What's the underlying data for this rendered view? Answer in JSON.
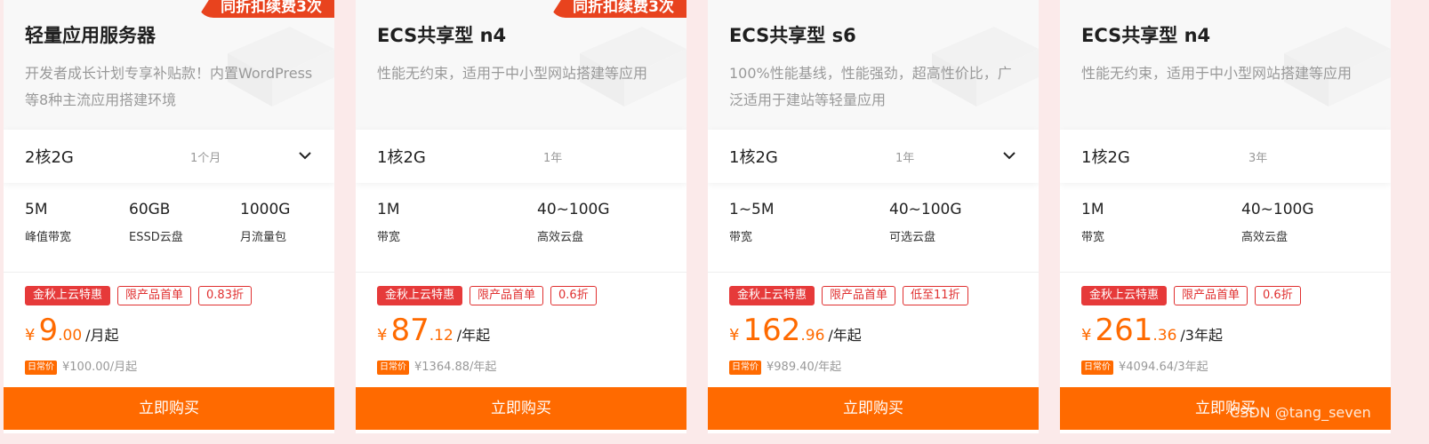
{
  "colors": {
    "accent": "#ff6a00",
    "ribbon": "#e8431e",
    "tag_red": "#e63a3a"
  },
  "icons": {
    "dropdown": "chevron-down-icon"
  },
  "cards": [
    {
      "ribbon": "同折扣续费3次",
      "title": "轻量应用服务器",
      "desc": "开发者成长计划专享补贴款！内置WordPress等8种主流应用搭建环境",
      "spec": "2核2G",
      "period": "1个月",
      "has_dropdown": true,
      "specs": [
        {
          "value": "5M",
          "label": "峰值带宽"
        },
        {
          "value": "60GB",
          "label": "ESSD云盘"
        },
        {
          "value": "1000G",
          "label": "月流量包"
        }
      ],
      "tags": [
        "金秋上云特惠",
        "限产品首单",
        "0.83折"
      ],
      "price": {
        "yen": "¥",
        "int": "9",
        "dec": ".00",
        "unit": "/月起"
      },
      "orig": {
        "badge": "日常价",
        "text": "¥100.00/月起"
      },
      "buy": "立即购买"
    },
    {
      "ribbon": "同折扣续费3次",
      "title": "ECS共享型 n4",
      "desc": "性能无约束，适用于中小型网站搭建等应用",
      "spec": "1核2G",
      "period": "1年",
      "has_dropdown": false,
      "specs": [
        {
          "value": "1M",
          "label": "带宽"
        },
        {
          "value": "40~100G",
          "label": "高效云盘"
        }
      ],
      "tags": [
        "金秋上云特惠",
        "限产品首单",
        "0.6折"
      ],
      "price": {
        "yen": "¥",
        "int": "87",
        "dec": ".12",
        "unit": "/年起"
      },
      "orig": {
        "badge": "日常价",
        "text": "¥1364.88/年起"
      },
      "buy": "立即购买"
    },
    {
      "ribbon": "",
      "title": "ECS共享型 s6",
      "desc": "100%性能基线，性能强劲，超高性价比，广泛适用于建站等轻量应用",
      "spec": "1核2G",
      "period": "1年",
      "has_dropdown": true,
      "specs": [
        {
          "value": "1~5M",
          "label": "带宽"
        },
        {
          "value": "40~100G",
          "label": "可选云盘"
        }
      ],
      "tags": [
        "金秋上云特惠",
        "限产品首单",
        "低至11折"
      ],
      "price": {
        "yen": "¥",
        "int": "162",
        "dec": ".96",
        "unit": "/年起"
      },
      "orig": {
        "badge": "日常价",
        "text": "¥989.40/年起"
      },
      "buy": "立即购买"
    },
    {
      "ribbon": "",
      "title": "ECS共享型 n4",
      "desc": "性能无约束，适用于中小型网站搭建等应用",
      "spec": "1核2G",
      "period": "3年",
      "has_dropdown": false,
      "specs": [
        {
          "value": "1M",
          "label": "带宽"
        },
        {
          "value": "40~100G",
          "label": "高效云盘"
        }
      ],
      "tags": [
        "金秋上云特惠",
        "限产品首单",
        "0.6折"
      ],
      "price": {
        "yen": "¥",
        "int": "261",
        "dec": ".36",
        "unit": "/3年起"
      },
      "orig": {
        "badge": "日常价",
        "text": "¥4094.64/3年起"
      },
      "buy": "立即购买"
    }
  ],
  "watermark": "CSDN @tang_seven"
}
